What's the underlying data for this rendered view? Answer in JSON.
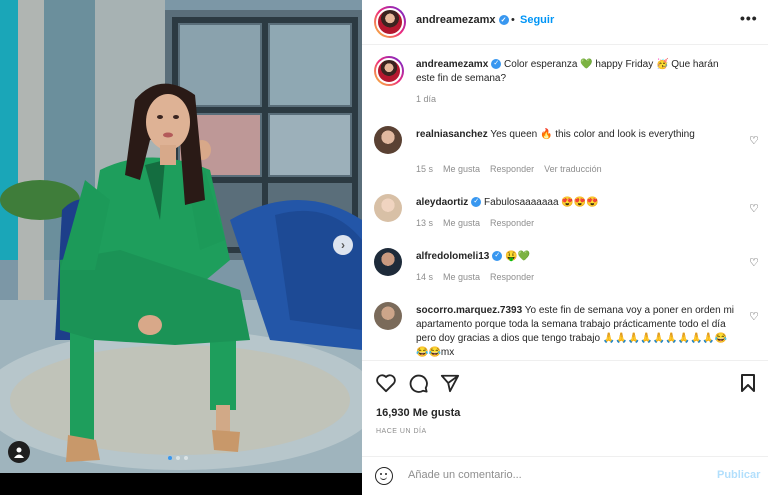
{
  "post": {
    "author": "andreamezamx",
    "follow_label": "Seguir",
    "separator": "•",
    "more_label": "•••",
    "caption": {
      "username": "andreamezamx",
      "text": "Color esperanza 💚 happy Friday 🥳 Que harán este fin de semana?",
      "time": "1 día"
    },
    "comments": [
      {
        "username": "realniasanchez",
        "verified": false,
        "text": "Yes queen 🔥 this color and look is everything",
        "time": "15 s",
        "likes": "Me gusta",
        "reply": "Responder",
        "translate": "Ver traducción"
      },
      {
        "username": "aleydaortiz",
        "verified": true,
        "text": "Fabulosaaaaaaa 😍😍😍",
        "time": "13 s",
        "likes": "Me gusta",
        "reply": "Responder",
        "translate": ""
      },
      {
        "username": "alfredolomeli13",
        "verified": true,
        "text": "🤑💚",
        "time": "14 s",
        "likes": "Me gusta",
        "reply": "Responder",
        "translate": ""
      },
      {
        "username": "socorro.marquez.7393",
        "verified": false,
        "text": "Yo este fin de semana voy a poner en orden mi apartamento porque toda la semana trabajo prácticamente todo el día pero doy gracias a dios que tengo trabajo 🙏🙏🙏🙏🙏🙏🙏🙏🙏😂😂😂mx",
        "time": "",
        "likes": "",
        "reply": "",
        "translate": ""
      }
    ],
    "likes_count": "16,930 Me gusta",
    "posted_ago": "HACE UN DÍA",
    "comment_placeholder": "Añade un comentario...",
    "publish_label": "Publicar",
    "carousel": {
      "total": 3,
      "active": 1
    }
  },
  "icons": [
    "heart-icon",
    "comment-icon",
    "share-icon",
    "bookmark-icon",
    "emoji-icon",
    "user-tag-icon",
    "chevron-right-icon",
    "verified-icon",
    "more-icon"
  ],
  "colors": {
    "accent": "#0095f6",
    "verified": "#3897f0",
    "suit": "#1e9e5c",
    "chair": "#1d3f8a"
  }
}
